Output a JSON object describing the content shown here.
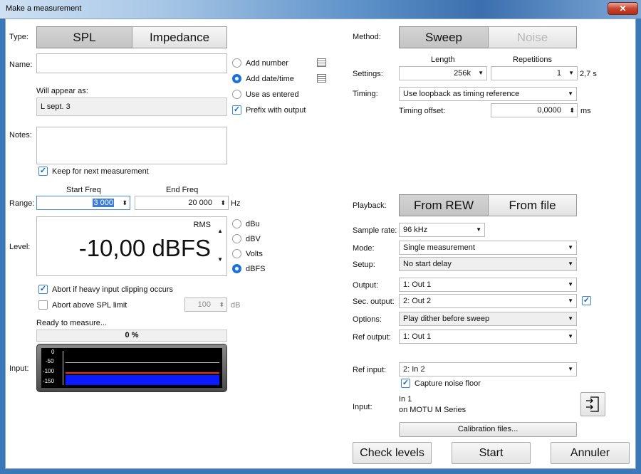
{
  "window": {
    "title": "Make a measurement",
    "close_glyph": "✕"
  },
  "type": {
    "label": "Type:",
    "options": [
      "SPL",
      "Impedance"
    ],
    "selected": "SPL"
  },
  "name": {
    "label": "Name:",
    "value": "",
    "options": [
      {
        "label": "Add number",
        "checked": false
      },
      {
        "label": "Add date/time",
        "checked": true
      },
      {
        "label": "Use as entered",
        "checked": false
      }
    ],
    "prefix_label": "Prefix with output",
    "prefix_checked": true,
    "will_appear_label": "Will appear as:",
    "will_appear_value": "L sept. 3"
  },
  "notes": {
    "label": "Notes:",
    "value": "",
    "keep_label": "Keep for next measurement",
    "keep_checked": true
  },
  "range": {
    "label": "Range:",
    "start_label": "Start Freq",
    "end_label": "End Freq",
    "start_value": "3 000",
    "end_value": "20 000",
    "unit": "Hz"
  },
  "level": {
    "label": "Level:",
    "mode": "RMS",
    "value": "-10,00 dBFS",
    "units": [
      {
        "label": "dBu",
        "checked": false
      },
      {
        "label": "dBV",
        "checked": false
      },
      {
        "label": "Volts",
        "checked": false
      },
      {
        "label": "dBFS",
        "checked": true
      }
    ]
  },
  "clipping": {
    "abort_clip_label": "Abort if heavy input clipping occurs",
    "abort_clip_checked": true,
    "abort_spl_label": "Abort above SPL limit",
    "abort_spl_checked": false,
    "spl_limit": "100",
    "spl_unit": "dB"
  },
  "progress": {
    "status": "Ready to measure...",
    "percent_text": "0 %",
    "percent": 0
  },
  "input_meter": {
    "label": "Input:",
    "ticks": [
      "0",
      "-50",
      "-100",
      "-150"
    ],
    "colors": {
      "bar": "#0a1bff",
      "trace": "#ff2020"
    }
  },
  "method": {
    "label": "Method:",
    "options": [
      "Sweep",
      "Noise"
    ],
    "selected": "Sweep"
  },
  "settings": {
    "label": "Settings:",
    "length_header": "Length",
    "repetitions_header": "Repetitions",
    "length": "256k",
    "repetitions": "1",
    "duration": "2,7 s"
  },
  "timing": {
    "label": "Timing:",
    "value": "Use loopback as timing reference",
    "offset_label": "Timing offset:",
    "offset_value": "0,0000",
    "offset_unit": "ms"
  },
  "playback": {
    "label": "Playback:",
    "options": [
      "From REW",
      "From file"
    ],
    "selected": "From REW"
  },
  "sample_rate": {
    "label": "Sample rate:",
    "value": "96 kHz"
  },
  "mode": {
    "label": "Mode:",
    "value": "Single measurement"
  },
  "setup": {
    "label": "Setup:",
    "value": "No start delay"
  },
  "output": {
    "label": "Output:",
    "value": "1: Out 1"
  },
  "sec_output": {
    "label": "Sec. output:",
    "value": "2: Out 2",
    "checked": true
  },
  "options": {
    "label": "Options:",
    "value": "Play dither before sweep"
  },
  "ref_output": {
    "label": "Ref output:",
    "value": "1: Out 1"
  },
  "ref_input": {
    "label": "Ref input:",
    "value": "2: In 2",
    "noise_floor_label": "Capture noise floor",
    "noise_floor_checked": true
  },
  "input": {
    "label": "Input:",
    "line1": "In 1",
    "line2": "on MOTU M Series"
  },
  "buttons": {
    "calibration": "Calibration files...",
    "check_levels": "Check levels",
    "start": "Start",
    "cancel": "Annuler"
  },
  "glyphs": {
    "check": "✓",
    "dropdown": "▼",
    "spin": "⬍",
    "spin_up": "▲",
    "spin_down": "▼"
  }
}
